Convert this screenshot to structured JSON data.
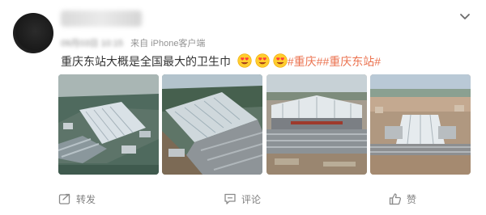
{
  "post": {
    "source": "来自 iPhone客户端",
    "date_blurred": "09月03日 10:15",
    "text": "重庆东站大概是全国最大的卫生巾",
    "emojis": [
      "heart-eyes-emoji",
      "heart-eyes-emoji",
      "heart-eyes-emoji"
    ],
    "topics": [
      "#重庆#",
      "#重庆东站#"
    ],
    "images": [
      "aerial-station-image-1",
      "aerial-station-image-2",
      "aerial-station-image-3",
      "aerial-station-image-4"
    ]
  },
  "actions": {
    "repost": "转发",
    "comment": "评论",
    "like": "赞"
  },
  "colors": {
    "topic": "#eb7350",
    "meta_text": "#939393",
    "action_text": "#808080",
    "body_text": "#333333"
  },
  "icons": [
    "expand-chevron-icon",
    "repost-icon",
    "comment-icon",
    "like-icon"
  ]
}
